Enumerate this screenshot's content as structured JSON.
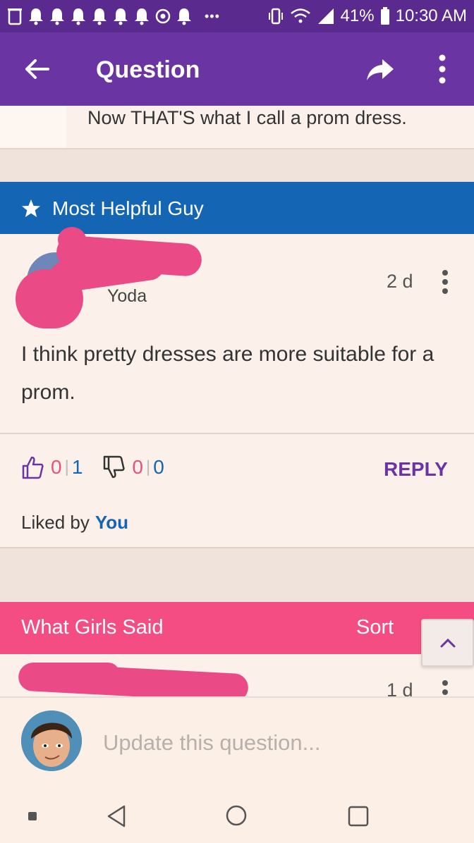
{
  "status_bar": {
    "battery": "41%",
    "time": "10:30 AM",
    "dots": "•••"
  },
  "app_bar": {
    "title": "Question"
  },
  "previous_answer": {
    "text": "Now THAT'S what I call a prom dress."
  },
  "most_helpful": {
    "label": "Most Helpful Guy",
    "username": "Yoda",
    "time": "2 d",
    "text": "I think pretty dresses are more suitable for a prom.",
    "likes": {
      "left": "0",
      "right": "1"
    },
    "dislikes": {
      "left": "0",
      "right": "0"
    },
    "reply_label": "REPLY",
    "liked_by_label": "Liked by",
    "liked_by_name": "You"
  },
  "girls_section": {
    "label": "What Girls Said",
    "sort_label": "Sort",
    "first_time": "1 d"
  },
  "composer": {
    "placeholder": "Update this question..."
  },
  "colors": {
    "status_bar": "#5a2a8f",
    "app_bar": "#6a35a3",
    "most_helpful_banner": "#1565b5",
    "girls_banner": "#f34d84",
    "redaction": "#ea4a86"
  }
}
